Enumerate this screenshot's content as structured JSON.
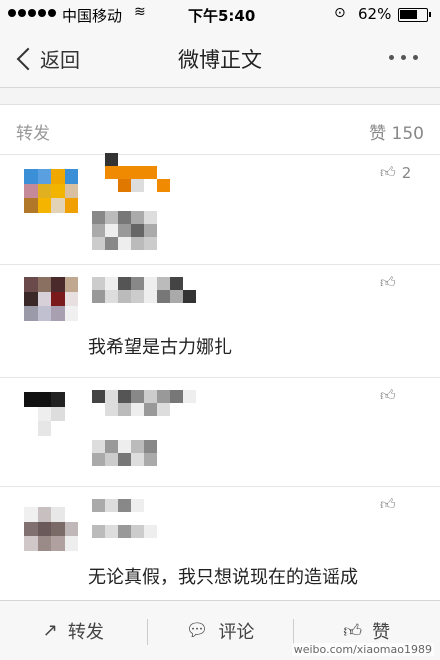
{
  "status_bar": {
    "carrier": "中国移动",
    "time": "下午5:40",
    "battery": "62%"
  },
  "nav": {
    "back_label": "返回",
    "title": "微博正文"
  },
  "tabs": {
    "repost": "转发",
    "likes": "赞 150"
  },
  "comments": [
    {
      "like_count": "2",
      "text": ""
    },
    {
      "like_count": "",
      "text": "我希望是古力娜扎"
    },
    {
      "like_count": "",
      "text": ""
    },
    {
      "like_count": "",
      "text": "无论真假，我只想说现在的造谣成"
    }
  ],
  "toolbar": {
    "repost": "转发",
    "comment": "评论",
    "like": "赞"
  },
  "watermark": "weibo.com/xiaomao1989",
  "colors": {
    "background": "#f4f4f4",
    "bar": "#f7f7f7",
    "text": "#333333",
    "muted": "#999999"
  }
}
